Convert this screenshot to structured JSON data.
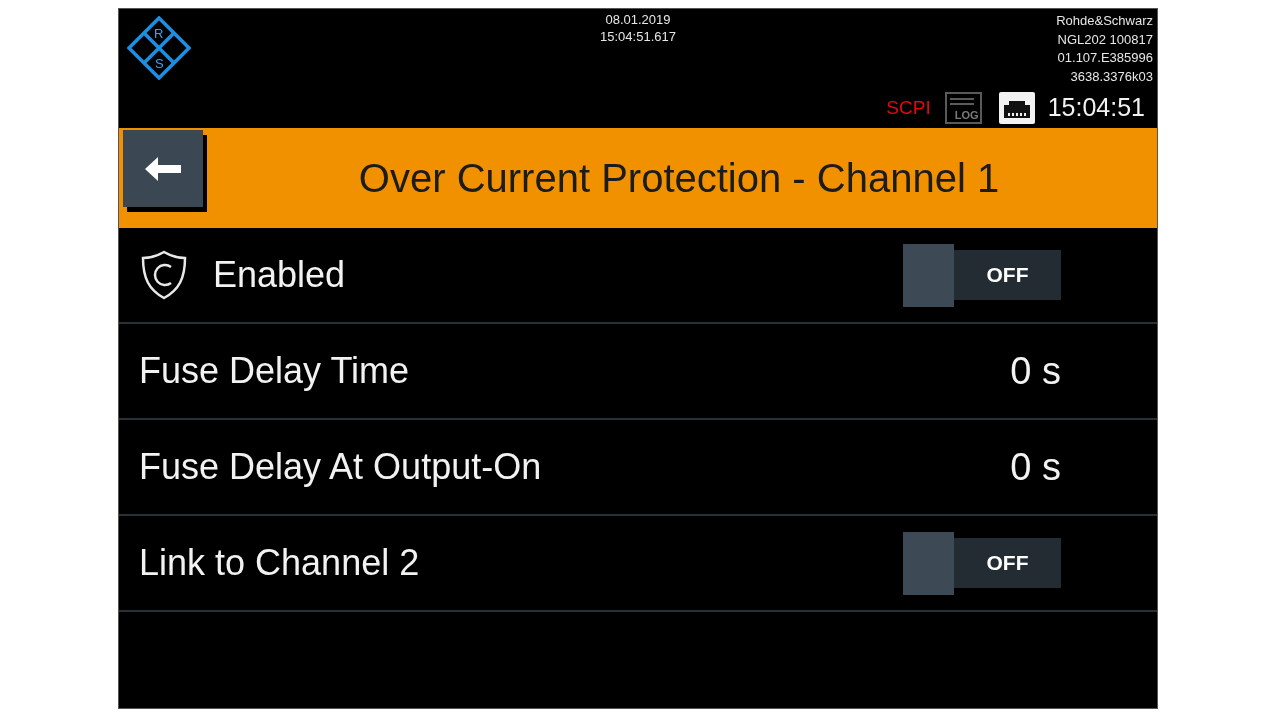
{
  "header": {
    "logo": {
      "letters": [
        "R",
        "S"
      ]
    },
    "date": "08.01.2019",
    "time_precise": "15:04:51.617",
    "device_info": [
      "Rohde&Schwarz",
      "NGL202 100817",
      "01.107.E385996",
      "3638.3376k03"
    ],
    "status": {
      "scpi": "SCPI",
      "log": {
        "label": "LOG",
        "active": false
      },
      "clock": "15:04:51"
    }
  },
  "title_bar": {
    "title": "Over Current Protection - Channel 1"
  },
  "settings": [
    {
      "kind": "enable_toggle",
      "label": "Enabled",
      "on": false,
      "state_label": "OFF"
    },
    {
      "kind": "value",
      "label": "Fuse Delay Time",
      "value": "0 s"
    },
    {
      "kind": "value",
      "label": "Fuse Delay At Output-On",
      "value": "0 s"
    },
    {
      "kind": "toggle",
      "label": "Link to Channel 2",
      "on": false,
      "state_label": "OFF"
    }
  ]
}
